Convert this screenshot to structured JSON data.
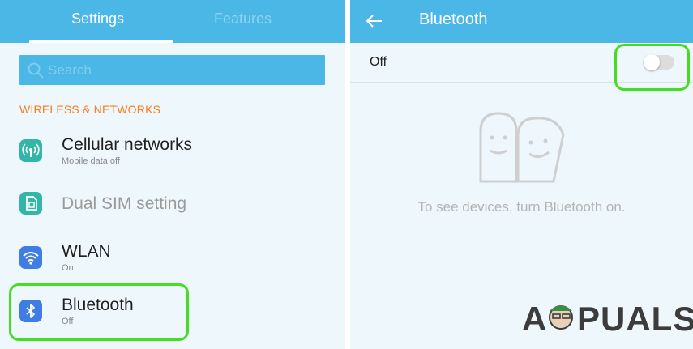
{
  "left": {
    "tabs": {
      "settings": "Settings",
      "features": "Features"
    },
    "search": {
      "placeholder": "Search"
    },
    "section_title": "WIRELESS & NETWORKS",
    "items": [
      {
        "title": "Cellular networks",
        "subtitle": "Mobile data off",
        "icon": "cellular-antenna-icon"
      },
      {
        "title": "Dual SIM setting",
        "icon": "dual-sim-icon"
      },
      {
        "title": "WLAN",
        "subtitle": "On",
        "icon": "wifi-icon"
      },
      {
        "title": "Bluetooth",
        "subtitle": "Off",
        "icon": "bluetooth-icon"
      }
    ]
  },
  "right": {
    "title": "Bluetooth",
    "toggle_label": "Off",
    "toggle_state": false,
    "empty_hint": "To see devices, turn Bluetooth on."
  },
  "watermark": "APPUALS",
  "colors": {
    "header": "#4bb7e6",
    "highlight": "#44dd22",
    "section": "#ff7a1a",
    "teal_icon": "#33b5a7",
    "blue_icon": "#3f7de2"
  }
}
